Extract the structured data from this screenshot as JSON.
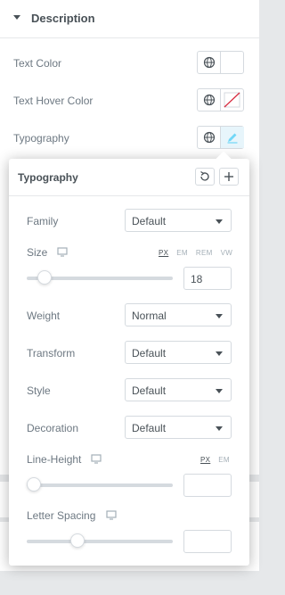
{
  "section": {
    "title": "Description"
  },
  "controls": {
    "text_color": {
      "label": "Text Color"
    },
    "text_hover_color": {
      "label": "Text Hover Color"
    },
    "typography": {
      "label": "Typography"
    }
  },
  "typography_popover": {
    "title": "Typography",
    "family": {
      "label": "Family",
      "value": "Default"
    },
    "size": {
      "label": "Size",
      "units": [
        "PX",
        "EM",
        "REM",
        "VW"
      ],
      "active_unit": "PX",
      "value": "18",
      "slider_fraction": 0.08
    },
    "weight": {
      "label": "Weight",
      "value": "Normal"
    },
    "transform": {
      "label": "Transform",
      "value": "Default"
    },
    "style": {
      "label": "Style",
      "value": "Default"
    },
    "decoration": {
      "label": "Decoration",
      "value": "Default"
    },
    "line_height": {
      "label": "Line-Height",
      "units": [
        "PX",
        "EM"
      ],
      "active_unit": "PX",
      "value": "",
      "slider_fraction": 0.0
    },
    "letter_spacing": {
      "label": "Letter Spacing",
      "value": "",
      "slider_fraction": 0.33
    }
  },
  "colors": {
    "accent": "#71d7f7",
    "text": "#6d7882",
    "heading": "#495157",
    "border": "#d5dadf",
    "clear_swatch_line": "#d72b3f"
  },
  "icons": [
    "caret-down-icon",
    "globe-icon",
    "pencil-icon",
    "reset-icon",
    "plus-icon",
    "monitor-icon"
  ]
}
